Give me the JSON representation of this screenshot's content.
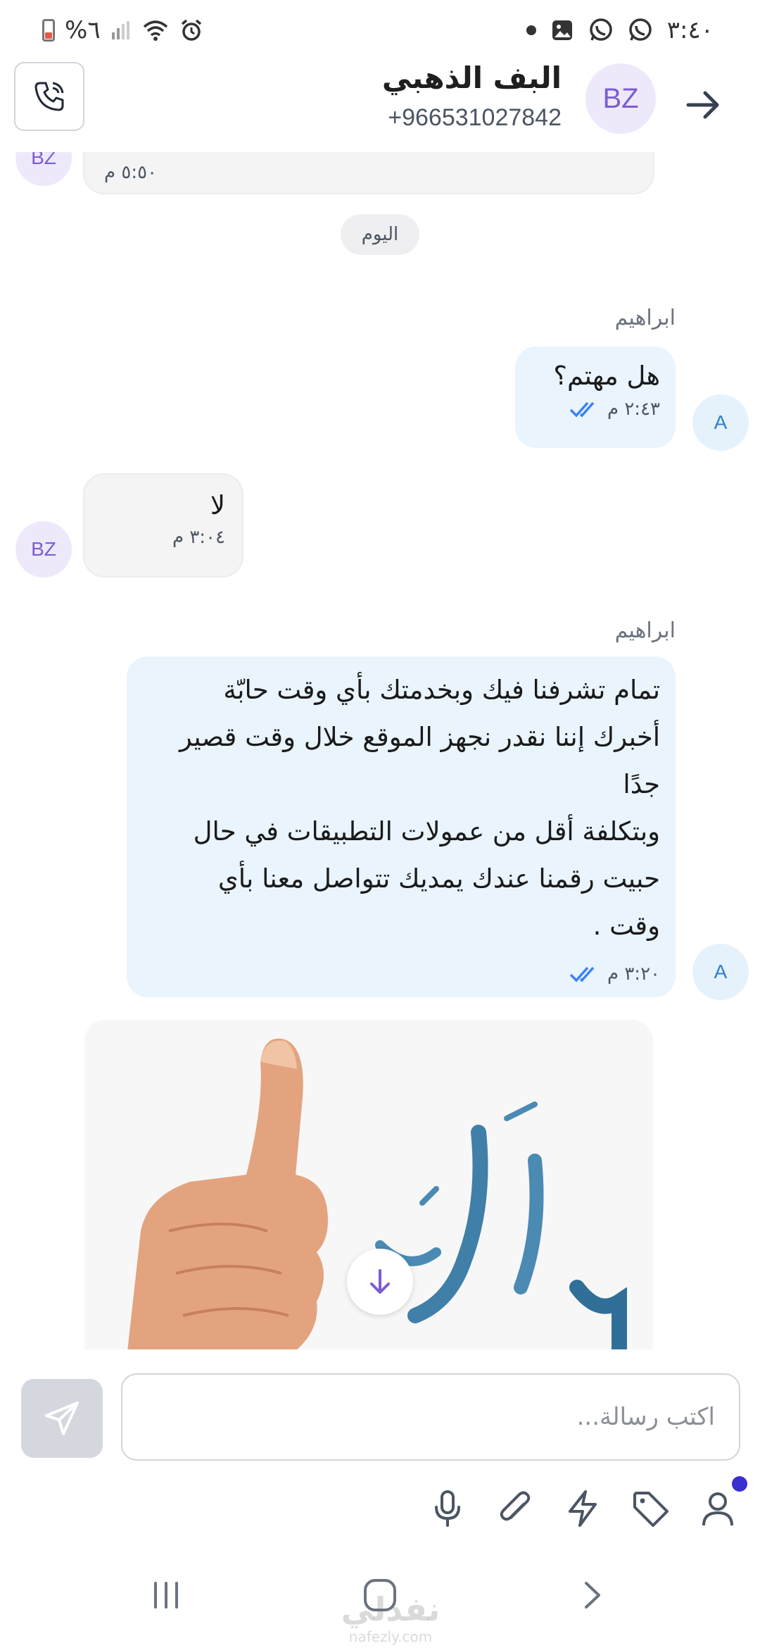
{
  "status_bar": {
    "time": "٣:٤٠",
    "battery": "%٦"
  },
  "header": {
    "contact_name": "البف الذهبي",
    "contact_phone": "+966531027842",
    "avatar_initials": "BZ"
  },
  "chat": {
    "prev_message": {
      "time": "٥:٥٠ م",
      "avatar": "BZ"
    },
    "date_divider": "اليوم",
    "messages": [
      {
        "direction": "out",
        "sender": "ابراهيم",
        "lines": [
          "هل مهتم؟"
        ],
        "time": "٢:٤٣ م",
        "avatar": "A"
      },
      {
        "direction": "in",
        "lines": [
          "لا"
        ],
        "time": "٣:٠٤ م",
        "avatar": "BZ"
      },
      {
        "direction": "out",
        "sender": "ابراهيم",
        "lines": [
          "تمام تشرفنا فيك وبخدمتك بأي وقت حابّة",
          "أخبرك إننا نقدر نجهز الموقع خلال وقت قصير",
          "جدًا",
          "وبتكلفة أقل من عمولات التطبيقات في حال",
          "حبيت رقمنا عندك يمديك تتواصل معنا بأي",
          "وقت ."
        ],
        "time": "٣:٢٠ م",
        "avatar": "A"
      }
    ]
  },
  "composer": {
    "placeholder": "اكتب رسالة..."
  },
  "watermark": {
    "main": "نفذلي",
    "sub": "nafezly.com"
  },
  "icons": {
    "back": "arrow-right-icon",
    "call": "phone-icon",
    "send": "paper-plane-icon",
    "mic": "microphone-icon",
    "attach": "paperclip-icon",
    "quick": "lightning-icon",
    "tag": "tag-icon",
    "user": "user-icon",
    "scroll": "arrow-down-icon"
  },
  "colors": {
    "accent": "#7c5cd6",
    "outgoing_bubble": "#e9f4fd",
    "incoming_bubble": "#f4f4f5",
    "read_ticks": "#3b82f6"
  }
}
